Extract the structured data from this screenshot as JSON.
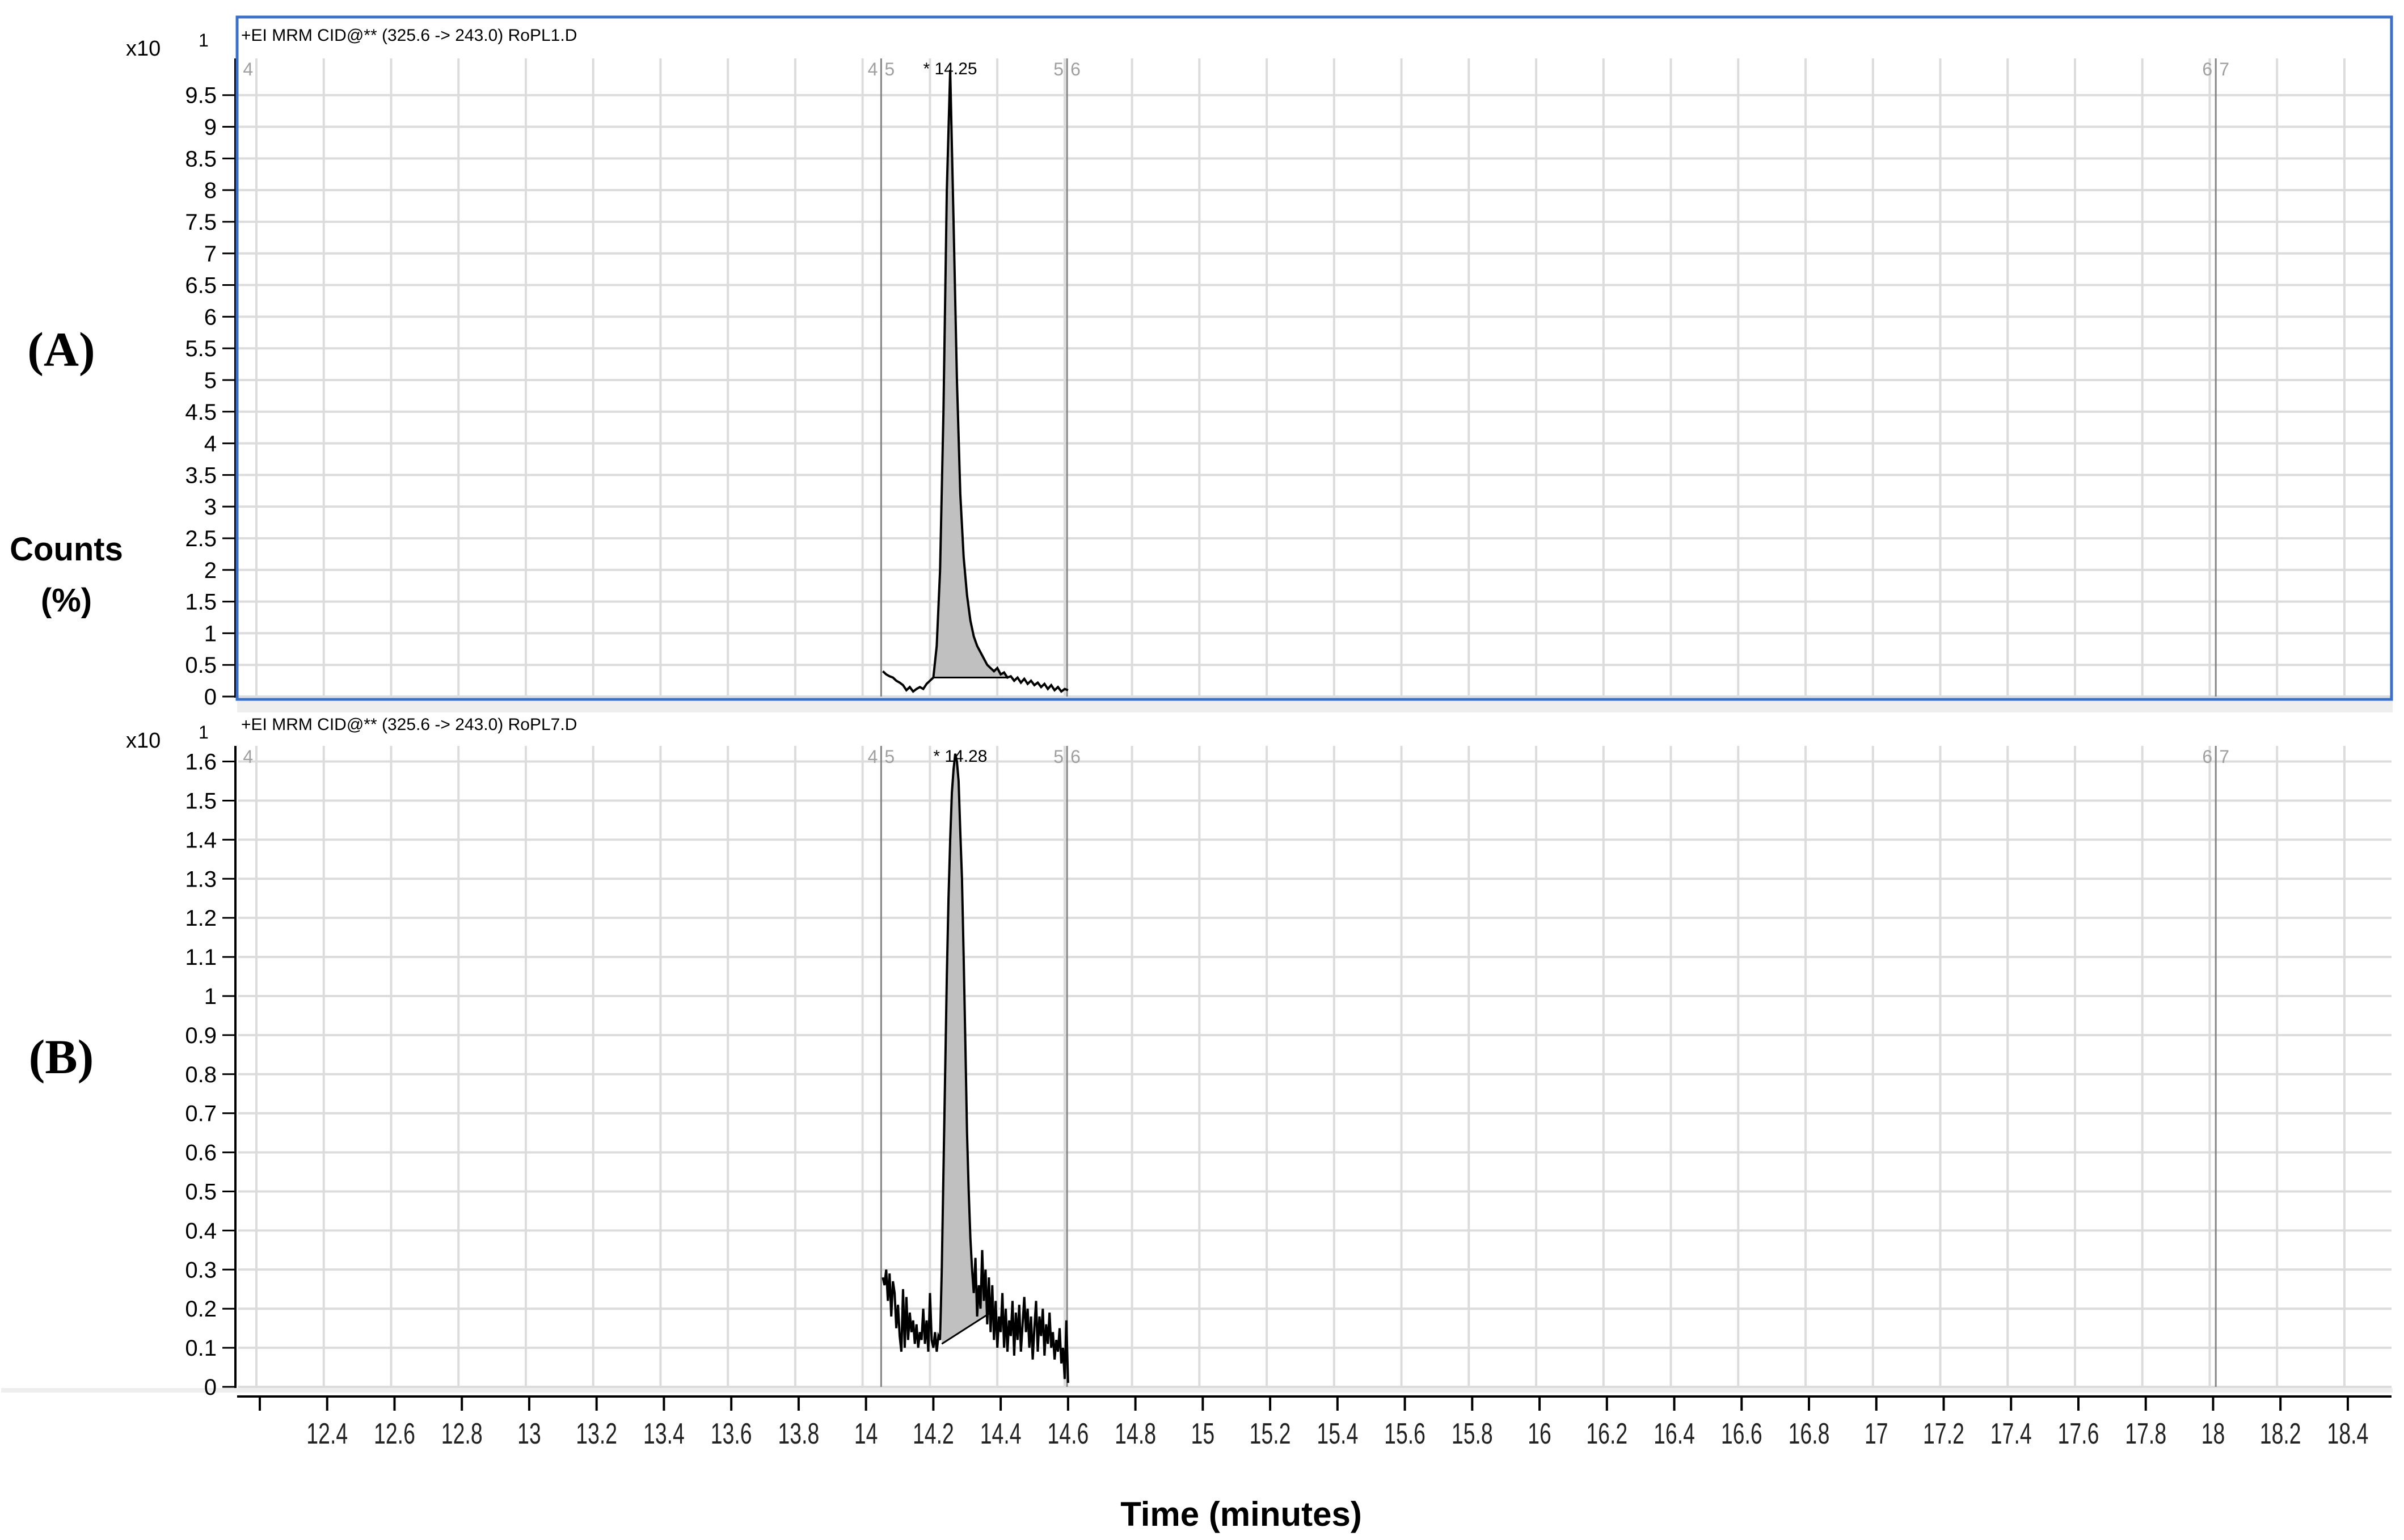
{
  "figure": {
    "ylabel_line1": "Counts",
    "ylabel_line2": "(%)",
    "xlabel": "Time (minutes)",
    "colors": {
      "selected_border": "#3a70c9",
      "grid": "#dcdcdc",
      "marker_line": "#858585",
      "marker_text": "#a0a0a0",
      "peak_fill": "#c0c0c0",
      "trace": "#000000"
    }
  },
  "x_axis": {
    "ticks": [
      12.2,
      12.4,
      12.6,
      12.8,
      13,
      13.2,
      13.4,
      13.6,
      13.8,
      14,
      14.2,
      14.4,
      14.6,
      14.8,
      15,
      15.2,
      15.4,
      15.6,
      15.8,
      16,
      16.2,
      16.4,
      16.6,
      16.8,
      17,
      17.2,
      17.4,
      17.6,
      17.8,
      18,
      18.2,
      18.4
    ],
    "tick_labels": [
      "",
      "12.4",
      "12.6",
      "12.8",
      "13",
      "13.2",
      "13.4",
      "13.6",
      "13.8",
      "14",
      "14.2",
      "14.4",
      "14.6",
      "14.8",
      "15",
      "15.2",
      "15.4",
      "15.6",
      "15.8",
      "16",
      "16.2",
      "16.4",
      "16.6",
      "16.8",
      "17",
      "17.2",
      "17.4",
      "17.6",
      "17.8",
      "18",
      "18.2",
      "18.4"
    ]
  },
  "chart_data": [
    {
      "type": "line",
      "panel_label": "(A)",
      "title": "+EI MRM CID@** (325.6 -> 243.0) RoPL1.D",
      "selected": true,
      "y_multiplier": "x10",
      "y_exponent": "1",
      "xlabel": "Time (minutes)",
      "ylabel": "Counts (%)",
      "xlim": [
        12.136,
        18.53
      ],
      "ylim": [
        0,
        10.08
      ],
      "grid": true,
      "yticks": [
        0,
        0.5,
        1,
        1.5,
        2,
        2.5,
        3,
        3.5,
        4,
        4.5,
        5,
        5.5,
        6,
        6.5,
        7,
        7.5,
        8,
        8.5,
        9,
        9.5
      ],
      "ytick_labels": [
        "0",
        "0.5",
        "1",
        "1.5",
        "2",
        "2.5",
        "3",
        "3.5",
        "4",
        "4.5",
        "5",
        "5.5",
        "6",
        "6.5",
        "7",
        "7.5",
        "8",
        "8.5",
        "9",
        "9.5"
      ],
      "segment_markers": [
        {
          "time": 12.14,
          "left": "",
          "right": "4",
          "line": false
        },
        {
          "time": 14.045,
          "left": "4",
          "right": "5",
          "line": true
        },
        {
          "time": 14.597,
          "left": "5",
          "right": "6",
          "line": true
        },
        {
          "time": 18.008,
          "left": "6",
          "right": "7",
          "line": true
        }
      ],
      "peak": {
        "label": "* 14.25",
        "rt": 14.25,
        "integration": {
          "start": 14.2,
          "end": 14.42,
          "baseline_start": 0.3,
          "baseline_end": 0.3
        }
      },
      "trace": {
        "x_start": 14.05,
        "x_step": 0.01,
        "y": [
          0.4,
          0.35,
          0.32,
          0.3,
          0.25,
          0.22,
          0.18,
          0.1,
          0.15,
          0.08,
          0.12,
          0.15,
          0.12,
          0.2,
          0.25,
          0.3,
          0.8,
          2.0,
          4.5,
          8.0,
          9.9,
          7.5,
          5.0,
          3.2,
          2.2,
          1.6,
          1.2,
          0.95,
          0.8,
          0.7,
          0.6,
          0.5,
          0.45,
          0.4,
          0.45,
          0.35,
          0.38,
          0.3,
          0.32,
          0.25,
          0.3,
          0.22,
          0.28,
          0.2,
          0.25,
          0.18,
          0.22,
          0.15,
          0.2,
          0.12,
          0.18,
          0.1,
          0.15,
          0.08,
          0.12,
          0.1
        ]
      }
    },
    {
      "type": "line",
      "panel_label": "(B)",
      "title": "+EI MRM CID@** (325.6 -> 243.0) RoPL7.D",
      "selected": false,
      "y_multiplier": "x10",
      "y_exponent": "1",
      "xlabel": "Time (minutes)",
      "ylabel": "Counts (%)",
      "xlim": [
        12.136,
        18.53
      ],
      "ylim": [
        0,
        1.64
      ],
      "grid": true,
      "yticks": [
        0,
        0.1,
        0.2,
        0.3,
        0.4,
        0.5,
        0.6,
        0.7,
        0.8,
        0.9,
        1,
        1.1,
        1.2,
        1.3,
        1.4,
        1.5,
        1.6
      ],
      "ytick_labels": [
        "0",
        "0.1",
        "0.2",
        "0.3",
        "0.4",
        "0.5",
        "0.6",
        "0.7",
        "0.8",
        "0.9",
        "1",
        "1.1",
        "1.2",
        "1.3",
        "1.4",
        "1.5",
        "1.6"
      ],
      "segment_markers": [
        {
          "time": 12.14,
          "left": "",
          "right": "4",
          "line": false
        },
        {
          "time": 14.045,
          "left": "4",
          "right": "5",
          "line": true
        },
        {
          "time": 14.597,
          "left": "5",
          "right": "6",
          "line": true
        },
        {
          "time": 18.008,
          "left": "6",
          "right": "7",
          "line": true
        }
      ],
      "peak": {
        "label": "* 14.28",
        "rt": 14.28,
        "integration": {
          "start": 14.225,
          "end": 14.37,
          "baseline_start": 0.11,
          "baseline_end": 0.19
        }
      },
      "trace": {
        "x_start": 14.05,
        "x_step": 0.005,
        "y": [
          0.28,
          0.26,
          0.3,
          0.22,
          0.29,
          0.18,
          0.27,
          0.24,
          0.15,
          0.21,
          0.13,
          0.09,
          0.25,
          0.1,
          0.23,
          0.12,
          0.19,
          0.14,
          0.17,
          0.11,
          0.16,
          0.1,
          0.14,
          0.12,
          0.2,
          0.11,
          0.17,
          0.09,
          0.24,
          0.12,
          0.1,
          0.14,
          0.09,
          0.13,
          0.12,
          0.3,
          0.55,
          0.8,
          1.05,
          1.25,
          1.4,
          1.52,
          1.58,
          1.62,
          1.6,
          1.55,
          1.42,
          1.3,
          1.1,
          0.88,
          0.65,
          0.5,
          0.38,
          0.3,
          0.24,
          0.33,
          0.18,
          0.26,
          0.2,
          0.35,
          0.22,
          0.3,
          0.16,
          0.28,
          0.14,
          0.26,
          0.12,
          0.22,
          0.1,
          0.18,
          0.14,
          0.24,
          0.1,
          0.2,
          0.09,
          0.17,
          0.13,
          0.22,
          0.08,
          0.19,
          0.12,
          0.21,
          0.09,
          0.16,
          0.23,
          0.14,
          0.2,
          0.1,
          0.18,
          0.07,
          0.15,
          0.22,
          0.09,
          0.18,
          0.13,
          0.2,
          0.08,
          0.16,
          0.11,
          0.19,
          0.1,
          0.14,
          0.07,
          0.12,
          0.09,
          0.15,
          0.06,
          0.1,
          0.02,
          0.17,
          0.01
        ]
      }
    }
  ]
}
